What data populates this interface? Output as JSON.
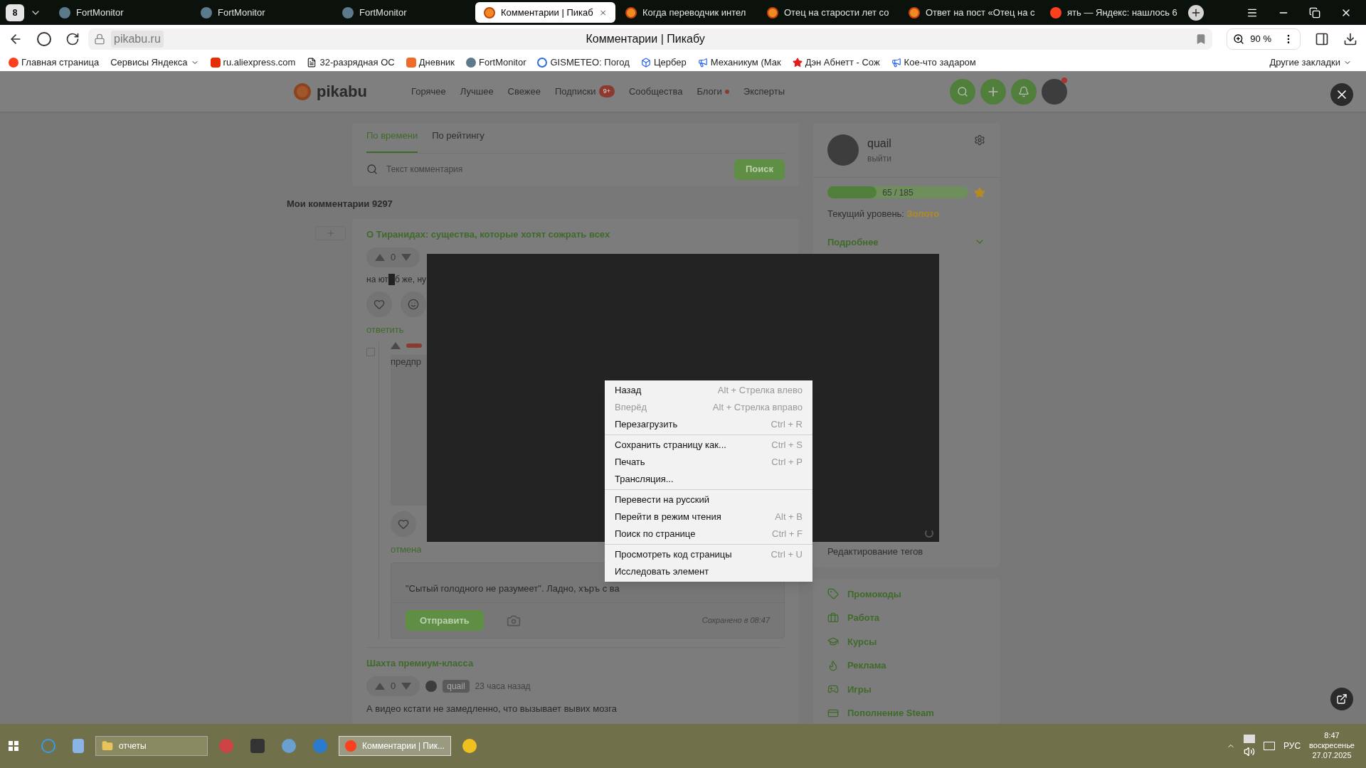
{
  "browser": {
    "tab_count": "8",
    "tabs": [
      {
        "title": "FortMonitor",
        "kind": "fortmonitor",
        "selected": false
      },
      {
        "title": "FortMonitor",
        "kind": "fortmonitor",
        "selected": false
      },
      {
        "title": "FortMonitor",
        "kind": "fortmonitor",
        "selected": false
      },
      {
        "title": "Комментарии | Пикаб",
        "kind": "pikabu",
        "selected": true
      },
      {
        "title": "Когда переводчик интел",
        "kind": "pikabu",
        "selected": false
      },
      {
        "title": "Отец на старости лет со",
        "kind": "pikabu",
        "selected": false
      },
      {
        "title": "Ответ на пост «Отец на с",
        "kind": "pikabu",
        "selected": false
      },
      {
        "title": "ять — Яндекс: нашлось 6",
        "kind": "yandex",
        "selected": false
      }
    ],
    "address": "pikabu.ru",
    "page_title": "Комментарии | Пикабу",
    "zoom": "90 %",
    "bookmarks": [
      {
        "label": "Главная страница",
        "kind": "yandex"
      },
      {
        "label": "Сервисы Яндекса",
        "kind": "menu"
      },
      {
        "label": "ru.aliexpress.com",
        "kind": "aliexpress"
      },
      {
        "label": "32-разрядная ОС",
        "kind": "page"
      },
      {
        "label": "Дневник",
        "kind": "diary"
      },
      {
        "label": "FortMonitor",
        "kind": "fortmonitor"
      },
      {
        "label": "GISMETEO: Погод",
        "kind": "gismeteo"
      },
      {
        "label": "Цербер",
        "kind": "cube"
      },
      {
        "label": "Механикум (Мак",
        "kind": "megaphone"
      },
      {
        "label": "Дэн Абнетт - Сож",
        "kind": "star"
      },
      {
        "label": "Кое-что задаром",
        "kind": "megaphone"
      }
    ],
    "other_bookmarks": "Другие закладки"
  },
  "site": {
    "logo": "pikabu",
    "nav": [
      {
        "label": "Горячее"
      },
      {
        "label": "Лучшее"
      },
      {
        "label": "Свежее"
      },
      {
        "label": "Подписки",
        "badge": "9+"
      },
      {
        "label": "Сообщества"
      },
      {
        "label": "Блоги",
        "dot": true
      },
      {
        "label": "Эксперты"
      }
    ]
  },
  "comments": {
    "sort_tabs": [
      {
        "label": "По времени",
        "selected": true
      },
      {
        "label": "По рейтингу",
        "selected": false
      }
    ],
    "search": {
      "placeholder": "Текст комментария",
      "button": "Поиск"
    },
    "heading": "Мои комментарии 9297",
    "post1": {
      "title": "О Тиранидах: существа, которые хотят сожрать всех",
      "votes": "0",
      "text_before": "на ют",
      "text_after": "б же, ну",
      "reply": "ответить",
      "nested": {
        "image_alt": "предпр",
        "cancel": "отмена",
        "reply_value": "\"Сытый голодного не разумеет\". Ладно, хъръ с ва",
        "send": "Отправить",
        "saved": "Сохранено в 08:47"
      }
    },
    "post2": {
      "title": "Шахта премиум-класса",
      "votes": "0",
      "author": "quail",
      "time": "23 часа назад",
      "text": "А видео кстати не замедленно, что вызывает вывих мозга"
    }
  },
  "sidebar": {
    "user": "quail",
    "logout": "выйти",
    "progress": {
      "level": 0.35,
      "reading": "65 / 185"
    },
    "level_label": "Текущий уровень: ",
    "level_value": "Золото",
    "more": "Подробнее",
    "tags_edit": "Редактирование тегов",
    "links": [
      {
        "label": "Промокоды",
        "kind": "tag"
      },
      {
        "label": "Работа",
        "kind": "briefcase"
      },
      {
        "label": "Курсы",
        "kind": "cap"
      },
      {
        "label": "Реклама",
        "kind": "flame"
      },
      {
        "label": "Игры",
        "kind": "gamepad"
      },
      {
        "label": "Пополнение Steam",
        "kind": "card"
      }
    ]
  },
  "context_menu": [
    [
      {
        "label": "Назад",
        "shortcut": "Alt + Стрелка влево",
        "disabled": false
      },
      {
        "label": "Вперёд",
        "shortcut": "Alt + Стрелка вправо",
        "disabled": true
      },
      {
        "label": "Перезагрузить",
        "shortcut": "Ctrl + R",
        "disabled": false
      }
    ],
    [
      {
        "label": "Сохранить страницу как...",
        "shortcut": "Ctrl + S",
        "disabled": false
      },
      {
        "label": "Печать",
        "shortcut": "Ctrl + P",
        "disabled": false
      },
      {
        "label": "Трансляция...",
        "disabled": false
      }
    ],
    [
      {
        "label": "Перевести на русский",
        "disabled": false
      },
      {
        "label": "Перейти в режим чтения",
        "shortcut": "Alt + B",
        "disabled": false
      },
      {
        "label": "Поиск по странице",
        "shortcut": "Ctrl + F",
        "disabled": false
      }
    ],
    [
      {
        "label": "Просмотреть код страницы",
        "shortcut": "Ctrl + U",
        "disabled": false
      },
      {
        "label": "Исследовать элемент",
        "disabled": false
      }
    ]
  ],
  "taskbar": {
    "windows": [
      {
        "label": "отчеты",
        "kind": "folder",
        "selected": false
      },
      {
        "label": "Комментарии | Пик...",
        "kind": "yandex",
        "selected": true
      }
    ],
    "language": "РУС",
    "time": "8:47",
    "day": "воскресенье",
    "date": "27.07.2025"
  }
}
